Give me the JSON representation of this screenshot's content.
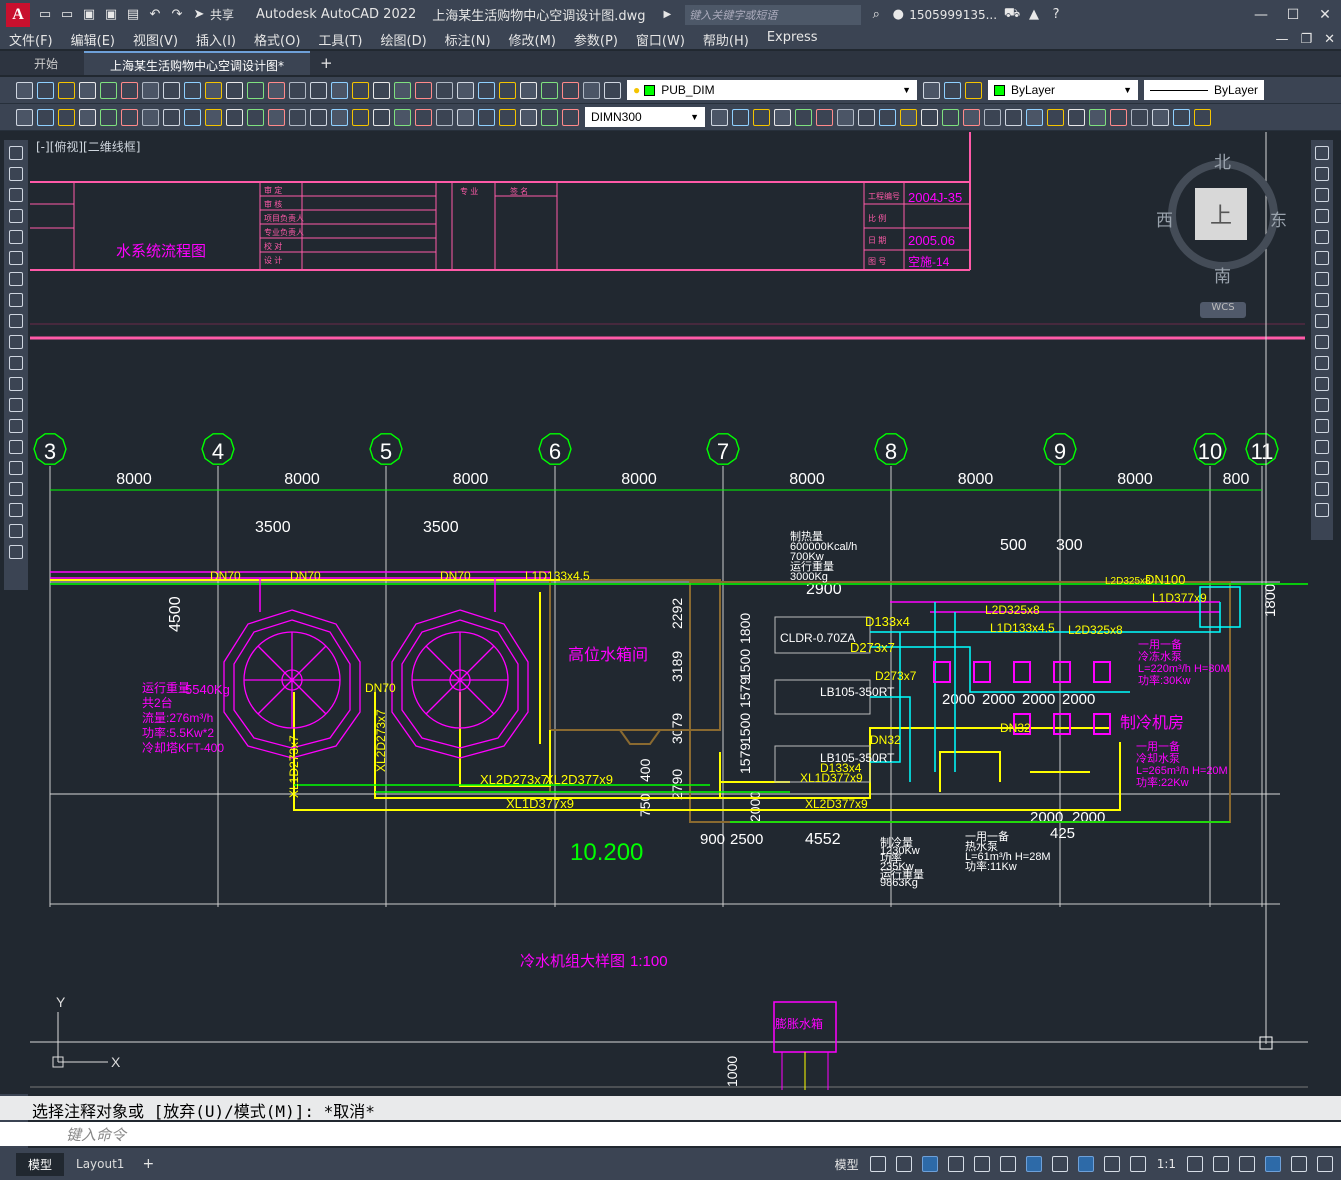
{
  "titlebar": {
    "app_title": "Autodesk AutoCAD 2022",
    "doc_title": "上海某生活购物中心空调设计图.dwg",
    "search_placeholder": "键入关键字或短语",
    "share_label": "共享",
    "user_label": "1505999135..."
  },
  "menus": [
    "文件(F)",
    "编辑(E)",
    "视图(V)",
    "插入(I)",
    "格式(O)",
    "工具(T)",
    "绘图(D)",
    "标注(N)",
    "修改(M)",
    "参数(P)",
    "窗口(W)",
    "帮助(H)",
    "Express"
  ],
  "tabs": [
    {
      "label": "开始",
      "active": false
    },
    {
      "label": "上海某生活购物中心空调设计图*",
      "active": true
    }
  ],
  "toolbar": {
    "layer_name": "PUB_DIM",
    "color_name": "ByLayer",
    "linetype_name": "ByLayer",
    "dimstyle_name": "DIMN300"
  },
  "viewport_label": "[-][俯视][二维线框]",
  "viewcube": {
    "north": "北",
    "south": "南",
    "east": "东",
    "west": "西",
    "face": "上",
    "wcs": "WCS"
  },
  "drawing": {
    "grid_labels": [
      "3",
      "4",
      "5",
      "6",
      "7",
      "8",
      "9",
      "10",
      "11"
    ],
    "spacings": [
      "8000",
      "8000",
      "8000",
      "8000",
      "8000",
      "8000",
      "8000",
      "800"
    ],
    "titleblock": {
      "project_no": "2004J-35",
      "date": "2005.06",
      "sheet": "空施-14",
      "drawing_name": "水系统流程图",
      "labels": [
        "审 定",
        "审 核",
        "项目负责人",
        "专业负责人",
        "校 对",
        "设 计"
      ],
      "col_labels": [
        "专 业",
        "签 名",
        "工程编号",
        "比 例",
        "日 期",
        "图 号"
      ]
    },
    "room_labels": [
      "高位水箱间",
      "制冷机房",
      "膨胀水箱"
    ],
    "elevation": "10.200",
    "caption": "冷水机组大样图",
    "caption_scale": "1:100",
    "dims": [
      "3500",
      "3500",
      "4500",
      "2900",
      "500",
      "300",
      "1800",
      "2292",
      "3189",
      "3079",
      "2790",
      "1800",
      "1500",
      "1579",
      "1500",
      "1579",
      "2000",
      "750",
      "400",
      "900",
      "2500",
      "4552",
      "2000",
      "2000",
      "2000",
      "2000",
      "2000",
      "2000",
      "425",
      "1000"
    ],
    "pipe_labels": [
      "XL2D273x7",
      "XL2D377x9",
      "XL1D377x9",
      "XL1D273x7",
      "XL2D273x7",
      "XL1D377x9",
      "XL2D377x9",
      "D133x4",
      "D133x4",
      "D273x7",
      "D273x7",
      "DN32",
      "DN100",
      "DN70",
      "DN70",
      "DN70",
      "DN70",
      "L1D133x4.5",
      "L2D325x8",
      "L2D325x8",
      "L1D377x9",
      "DN32",
      "L2D325x8",
      "L1D133x4.5"
    ],
    "equipment": {
      "tower_spec": [
        "运行重量",
        "共2台",
        "流量:276m³/h",
        "功率:5.5Kw*2",
        "冷却塔KFT-400"
      ],
      "tower_weight": "5540Kg",
      "boiler_spec": [
        "制热量",
        "600000Kcal/h",
        "700Kw",
        "运行重量",
        "3000Kg"
      ],
      "boiler_model": "CLDR-0.70ZA",
      "chiller1": "LB105-350RT",
      "chiller2": "LB105-350RT",
      "chiller_spec": [
        "制冷量",
        "1230Kw",
        "功率",
        "235Kw",
        "运行重量",
        "9863Kg"
      ],
      "pump1": [
        "一用一备",
        "冷冻水泵",
        "L=220m³/h H=30M",
        "功率:30Kw"
      ],
      "pump2": [
        "一用一备",
        "冷却水泵",
        "L=265m³/h H=20M",
        "功率:22Kw"
      ],
      "pump3": [
        "一用一备",
        "热水泵",
        "L=61m³/h H=28M",
        "功率:11Kw"
      ]
    },
    "axis_y": "Y",
    "axis_x": "X"
  },
  "command": {
    "history": "选择注释对象或 [放弃(U)/模式(M)]: *取消*",
    "prompt_placeholder": "键入命令"
  },
  "status": {
    "layouts": [
      {
        "label": "模型",
        "active": true
      },
      {
        "label": "Layout1",
        "active": false
      }
    ],
    "model_label": "模型",
    "scale": "1:1"
  },
  "colors": {
    "bg": "#212830",
    "grid": "#00ff00",
    "pipe": "#ffff00",
    "magenta": "#ff00ff",
    "cyan": "#00ffff",
    "pink": "#ff5aa8",
    "white": "#ffffff",
    "ui": "#3b4453"
  }
}
